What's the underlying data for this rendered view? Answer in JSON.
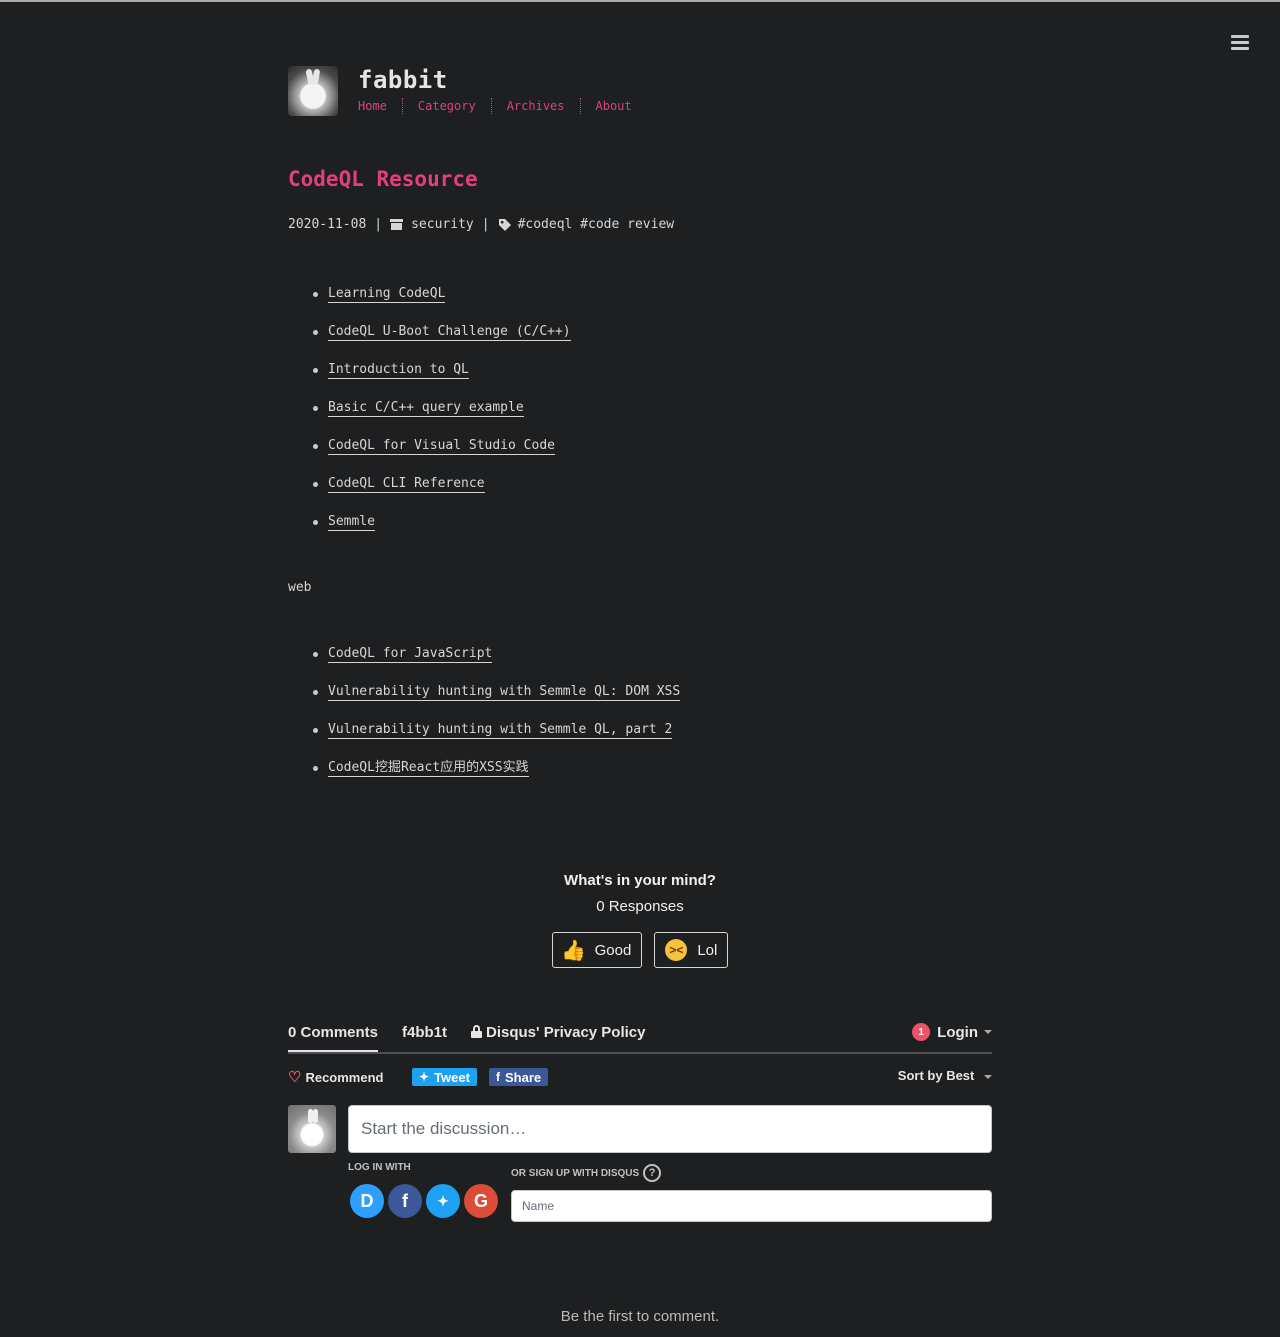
{
  "site": {
    "title": "fabbit",
    "nav": [
      "Home",
      "Category",
      "Archives",
      "About"
    ]
  },
  "post": {
    "title": "CodeQL Resource",
    "date": "2020-11-08",
    "separator": "|",
    "category": "security",
    "tags": "#codeql #code review",
    "links": [
      "Learning CodeQL",
      "CodeQL U-Boot Challenge (C/C++)",
      "Introduction to QL",
      "Basic C/C++ query example",
      "CodeQL for Visual Studio Code",
      "CodeQL CLI Reference",
      "Semmle"
    ],
    "section_label": "web",
    "web_links": [
      "CodeQL for JavaScript",
      "Vulnerability hunting with Semmle QL: DOM XSS",
      "Vulnerability hunting with Semmle QL, part 2",
      "CodeQL挖掘React应用的XSS实践"
    ]
  },
  "reactions": {
    "question": "What's in your mind?",
    "count": "0 Responses",
    "good": "Good",
    "lol": "Lol"
  },
  "disqus": {
    "comments_tab": "0 Comments",
    "forum_tab": "f4bb1t",
    "privacy_tab": "Disqus' Privacy Policy",
    "notification_count": "1",
    "login": "Login",
    "recommend": "Recommend",
    "tweet": "Tweet",
    "share": "Share",
    "sort": "Sort by Best",
    "textarea_placeholder": "Start the discussion…",
    "login_with": "LOG IN WITH",
    "signup": "OR SIGN UP WITH DISQUS",
    "help": "?",
    "name_placeholder": "Name",
    "empty_message": "Be the first to comment.",
    "social": [
      "D",
      "f",
      "G"
    ]
  },
  "colors": {
    "background": "#1d1f21",
    "accent": "#e33e7d",
    "text": "#d6d6d6"
  }
}
